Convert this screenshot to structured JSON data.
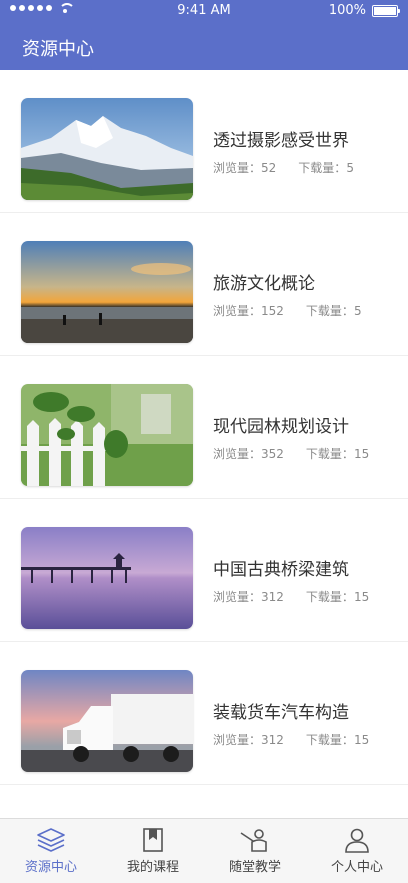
{
  "status_bar": {
    "time": "9:41 AM",
    "battery": "100%"
  },
  "header": {
    "title": "资源中心"
  },
  "items": [
    {
      "title": "透过摄影感受世界",
      "views_label": "浏览量：",
      "views": "52",
      "downloads_label": "下载量：",
      "downloads": "5",
      "image": "snowy-mountain-photo"
    },
    {
      "title": "旅游文化概论",
      "views_label": "浏览量：",
      "views": "152",
      "downloads_label": "下载量：",
      "downloads": "5",
      "image": "beach-sunset-photo"
    },
    {
      "title": "现代园林规划设计",
      "views_label": "浏览量：",
      "views": "352",
      "downloads_label": "下载量：",
      "downloads": "15",
      "image": "garden-fence-photo"
    },
    {
      "title": "中国古典桥梁建筑",
      "views_label": "浏览量：",
      "views": "312",
      "downloads_label": "下载量：",
      "downloads": "15",
      "image": "pier-dusk-photo"
    },
    {
      "title": "装载货车汽车构造",
      "views_label": "浏览量：",
      "views": "312",
      "downloads_label": "下载量：",
      "downloads": "15",
      "image": "semi-truck-photo"
    }
  ],
  "tabbar": {
    "tabs": [
      {
        "label": "资源中心",
        "icon": "layers-icon",
        "active": true
      },
      {
        "label": "我的课程",
        "icon": "bookmark-book-icon",
        "active": false
      },
      {
        "label": "随堂教学",
        "icon": "teacher-board-icon",
        "active": false
      },
      {
        "label": "个人中心",
        "icon": "user-icon",
        "active": false
      }
    ]
  },
  "colors": {
    "accent": "#5b6fc9",
    "text": "#333333",
    "meta": "#8a8a8a"
  }
}
